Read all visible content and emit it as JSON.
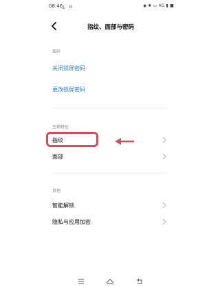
{
  "status_bar": {
    "time": "08:46",
    "right_text": "◆ ✱ ▭ 4G ▮ ■"
  },
  "header": {
    "title": "指纹、面部与密码"
  },
  "sections": {
    "password": {
      "label": "密码",
      "items": [
        "关闭锁屏密码",
        "更改锁屏密码"
      ]
    },
    "biometrics": {
      "label": "生物特征",
      "items": [
        "指纹",
        "面部"
      ]
    },
    "other": {
      "label": "其他",
      "items": [
        "智能解锁",
        "隐私与应用加密"
      ]
    }
  },
  "colors": {
    "link": "#2a7fd3",
    "annotation": "#d0505a"
  }
}
